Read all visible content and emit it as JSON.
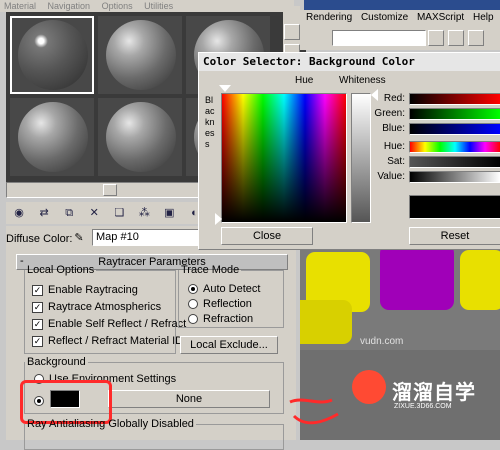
{
  "material_editor": {
    "menu": [
      "Material",
      "Navigation",
      "Options",
      "Utilities"
    ],
    "diffuse_label": "Diffuse Color:",
    "map_name": "Map #10",
    "rollout_title": "Raytracer Parameters",
    "local_options": {
      "legend": "Local Options",
      "items": [
        "Enable Raytracing",
        "Raytrace Atmospherics",
        "Enable Self Reflect / Refract",
        "Reflect / Refract Material IDs"
      ]
    },
    "trace_mode": {
      "legend": "Trace Mode",
      "options": [
        "Auto Detect",
        "Reflection",
        "Refraction"
      ]
    },
    "local_exclude_label": "Local Exclude...",
    "background": {
      "legend": "Background",
      "use_env_label": "Use Environment Settings",
      "none_label": "None",
      "swatch_color": "#000000"
    },
    "antialias_legend": "Ray Antialiasing Globally Disabled"
  },
  "main_window": {
    "menu": [
      "Rendering",
      "Customize",
      "MAXScript",
      "Help"
    ],
    "title_fragment": "Rendering Customize MAXScript Help"
  },
  "color_selector": {
    "title": "Color Selector: Background Color",
    "hue_label": "Hue",
    "whiteness_label": "Whiteness",
    "blackness_label": "Blackness",
    "sliders": [
      "Red:",
      "Green:",
      "Blue:",
      "Hue:",
      "Sat:",
      "Value:"
    ],
    "close_label": "Close",
    "reset_label": "Reset"
  },
  "watermark": {
    "url": "vudn.com",
    "brand": "溜溜自学",
    "sub": "ZIXUE.3D66.COM"
  },
  "colors": {
    "accent_red": "#ff2a2a",
    "yellow_box": "#e8e000",
    "purple_box": "#a000b8"
  }
}
